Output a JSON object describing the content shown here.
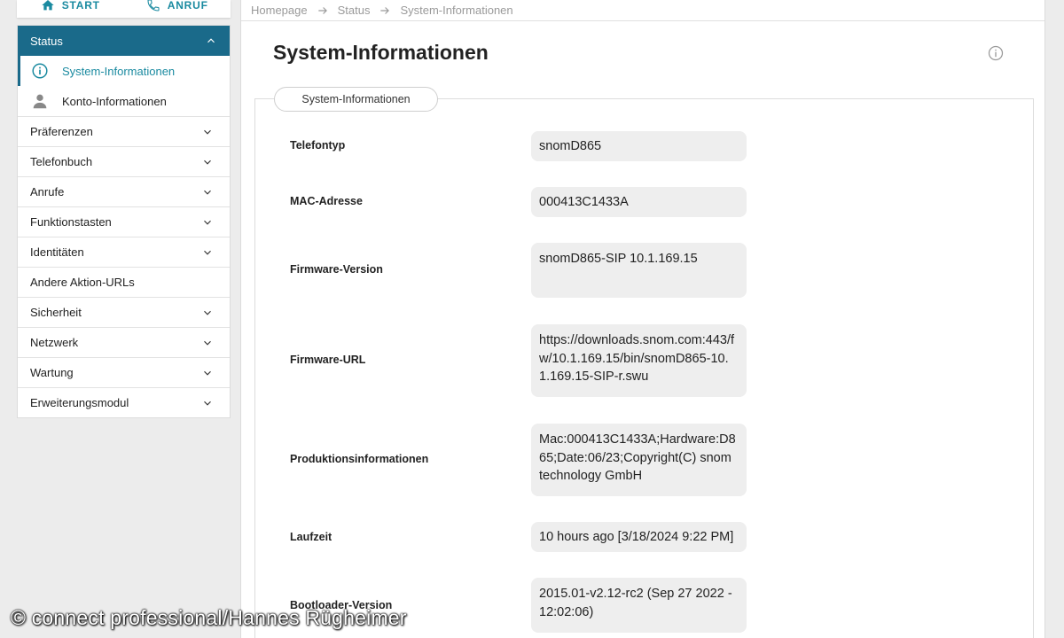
{
  "topnav": {
    "start_label": "START",
    "call_label": "ANRUF",
    "accent": "#1a8aa0"
  },
  "sidebar": {
    "section": {
      "label": "Status",
      "sub_items": [
        {
          "label": "System-Informationen",
          "icon": "info-icon",
          "active": true
        },
        {
          "label": "Konto-Informationen",
          "icon": "person-icon",
          "active": false
        }
      ]
    },
    "items": [
      {
        "label": "Präferenzen",
        "expandable": true
      },
      {
        "label": "Telefonbuch",
        "expandable": true
      },
      {
        "label": "Anrufe",
        "expandable": true
      },
      {
        "label": "Funktionstasten",
        "expandable": true
      },
      {
        "label": "Identitäten",
        "expandable": true
      },
      {
        "label": "Andere Aktion-URLs",
        "expandable": false
      },
      {
        "label": "Sicherheit",
        "expandable": true
      },
      {
        "label": "Netzwerk",
        "expandable": true
      },
      {
        "label": "Wartung",
        "expandable": true
      },
      {
        "label": "Erweiterungsmodul",
        "expandable": true
      }
    ],
    "header_color": "#1a6a8a"
  },
  "breadcrumb": [
    "Homepage",
    "Status",
    "System-Informationen"
  ],
  "main": {
    "title": "System-Informationen",
    "tab_label": "System-Informationen",
    "fields": [
      {
        "label": "Telefontyp",
        "value": "snomD865"
      },
      {
        "label": "MAC-Adresse",
        "value": "000413C1433A"
      },
      {
        "label": "Firmware-Version",
        "value": "snomD865-SIP 10.1.169.15"
      },
      {
        "label": "Firmware-URL",
        "value": "https://downloads.snom.com:443/fw/10.1.169.15/bin/snomD865-10.1.169.15-SIP-r.swu"
      },
      {
        "label": "Produktionsinformationen",
        "value": "Mac:000413C1433A;Hardware:D865;Date:06/23;Copyright(C) snom technology GmbH"
      },
      {
        "label": "Laufzeit",
        "value": "10 hours ago [3/18/2024 9:22 PM]"
      },
      {
        "label": "Bootloader-Version",
        "value": "2015.01-v2.12-rc2 (Sep 27 2022 - 12:02:06)"
      }
    ]
  },
  "watermark": "© connect professional/Hannes Rügheimer"
}
